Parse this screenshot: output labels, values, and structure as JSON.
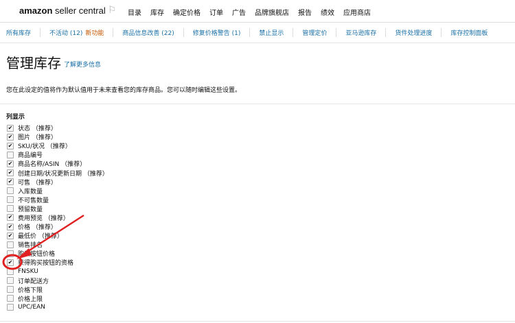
{
  "header": {
    "logo_bold": "amazon",
    "logo_rest": " seller central",
    "menu": [
      "目录",
      "库存",
      "确定价格",
      "订单",
      "广告",
      "品牌旗舰店",
      "报告",
      "绩效",
      "应用商店"
    ]
  },
  "subnav": [
    "所有库存",
    "不活动 (12)",
    "商品信息改善 (22)",
    "修复价格警告 (1)",
    "禁止显示",
    "管理定价",
    "亚马逊库存",
    "货件处理进度",
    "库存控制面板"
  ],
  "subnav_new": "新功能",
  "page": {
    "title": "管理库存",
    "learn_more": "了解更多信息",
    "description": "您在此设定的值将作为默认值用于未来查看您的库存商品。您可以随时编辑这些设置。",
    "columns_heading": "列显示"
  },
  "columns": [
    {
      "label": "状态 （推荐）",
      "checked": true
    },
    {
      "label": "图片 （推荐）",
      "checked": true
    },
    {
      "label": "SKU/状况 （推荐）",
      "checked": true
    },
    {
      "label": "商品编号",
      "checked": false
    },
    {
      "label": "商品名称/ASIN （推荐）",
      "checked": true
    },
    {
      "label": "创建日期/状况更新日期 （推荐）",
      "checked": true
    },
    {
      "label": "可售 （推荐）",
      "checked": true
    },
    {
      "label": "入库数量",
      "checked": false
    },
    {
      "label": "不可售数量",
      "checked": false
    },
    {
      "label": "预留数量",
      "checked": false
    },
    {
      "label": "费用预览 （推荐）",
      "checked": true
    },
    {
      "label": "价格 （推荐）",
      "checked": true
    },
    {
      "label": "最低价 （推荐）",
      "checked": true
    },
    {
      "label": "销售排名",
      "checked": false
    },
    {
      "label": "购买按钮价格",
      "checked": false
    },
    {
      "label": "获得购买按钮的资格",
      "checked": true
    },
    {
      "label": "FNSKU",
      "checked": false
    },
    {
      "label": "订单配送方",
      "checked": false
    },
    {
      "label": "价格下限",
      "checked": false
    },
    {
      "label": "价格上限",
      "checked": false
    },
    {
      "label": "UPC/EAN",
      "checked": false
    }
  ],
  "annotation_color": "#e02020"
}
